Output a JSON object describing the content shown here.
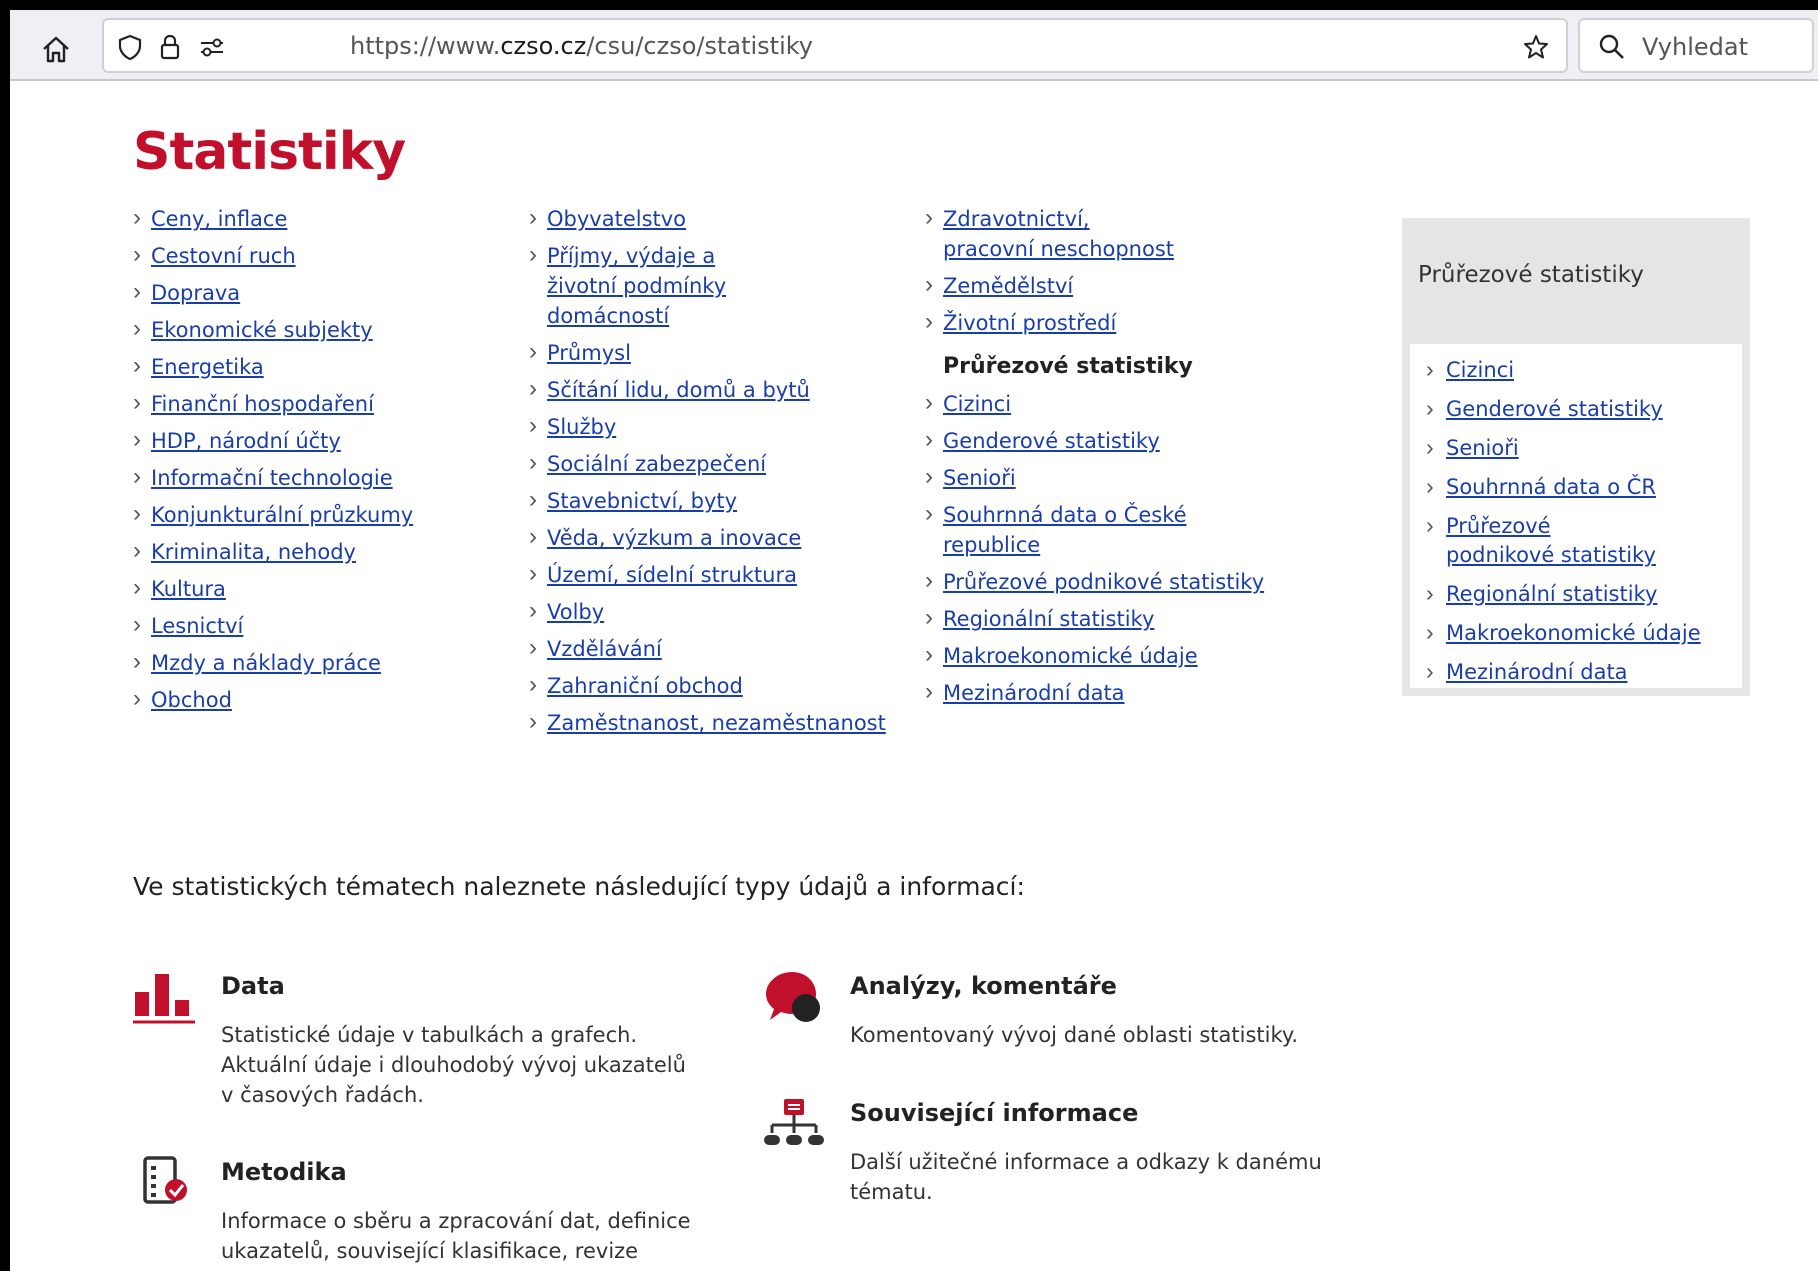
{
  "browser": {
    "url_prefix": "https://www.",
    "url_domain": "czso.cz",
    "url_path": "/csu/czso/statistiky",
    "search_placeholder": "Vyhledat"
  },
  "page_title": "Statistiky",
  "columns": [
    {
      "items": [
        "Ceny, inflace",
        "Cestovní ruch",
        "Doprava",
        "Ekonomické subjekty",
        "Energetika",
        "Finanční hospodaření",
        "HDP, národní účty",
        "Informační technologie",
        "Konjunkturální průzkumy",
        "Kriminalita, nehody",
        "Kultura",
        "Lesnictví",
        "Mzdy a náklady práce",
        "Obchod"
      ]
    },
    {
      "items": [
        "Obyvatelstvo",
        "Příjmy, výdaje a životní podmínky domácností",
        "Průmysl",
        "Sčítání lidu, domů a bytů",
        "Služby",
        "Sociální zabezpečení",
        "Stavebnictví, byty",
        "Věda, výzkum a inovace",
        "Území, sídelní struktura",
        "Volby",
        "Vzdělávání",
        "Zahraniční obchod",
        "Zaměstnanost, nezaměstnanost"
      ]
    },
    {
      "items": [
        "Zdravotnictví, pracovní neschopnost",
        "Zemědělství",
        "Životní prostředí"
      ],
      "section_title": "Průřezové statistiky",
      "section_items": [
        "Cizinci",
        "Genderové statistiky",
        "Senioři",
        "Souhrnná data o České republice",
        "Průřezové podnikové statistiky",
        "Regionální statistiky",
        "Makroekonomické údaje",
        "Mezinárodní data"
      ]
    }
  ],
  "sidebar": {
    "title": "Průřezové statistiky",
    "items": [
      "Cizinci",
      "Genderové statistiky",
      "Senioři",
      "Souhrnná data o ČR",
      "Průřezové podnikové statistiky",
      "Regionální statistiky",
      "Makroekonomické údaje",
      "Mezinárodní data"
    ]
  },
  "intro": "Ve statistických tématech naleznete následující typy údajů a informací:",
  "info": {
    "data": {
      "title": "Data",
      "text": "Statistické údaje v tabulkách a grafech. Aktuální údaje i dlouhodobý vývoj ukazatelů v časových řadách."
    },
    "metodika": {
      "title": "Metodika",
      "text": "Informace o sběru a zpracování dat, definice ukazatelů, související klasifikace, revize apod."
    },
    "analyzy": {
      "title": "Analýzy, komentáře",
      "text": "Komentovaný vývoj dané oblasti statistiky."
    },
    "souvisejici": {
      "title": "Související informace",
      "text": "Další užitečné informace a odkazy k danému tématu."
    }
  },
  "colors": {
    "accent": "#c0102c",
    "link": "#1a3ea8",
    "sidebar_bg": "#e5e5e5"
  },
  "icons": [
    "home-icon",
    "shield-icon",
    "lock-icon",
    "permissions-icon",
    "star-icon",
    "search-icon",
    "bar-chart-icon",
    "speech-bubble-icon",
    "checklist-icon",
    "hierarchy-icon"
  ]
}
